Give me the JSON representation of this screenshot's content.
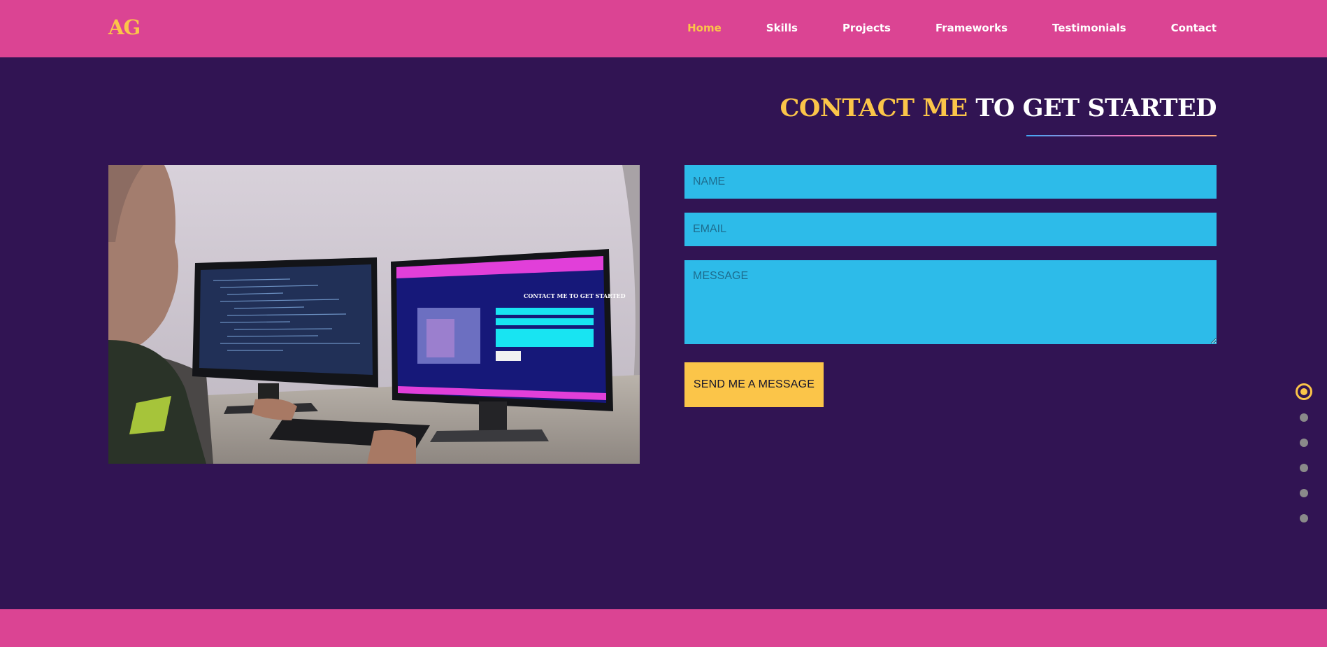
{
  "brand": {
    "logo": "AG"
  },
  "nav": {
    "items": [
      {
        "label": "Home",
        "active": true
      },
      {
        "label": "Skills"
      },
      {
        "label": "Projects"
      },
      {
        "label": "Frameworks"
      },
      {
        "label": "Testimonials"
      },
      {
        "label": "Contact"
      }
    ]
  },
  "contact": {
    "title_accent": "CONTACT ME",
    "title_rest": "TO GET STARTED",
    "name_placeholder": "NAME",
    "email_placeholder": "EMAIL",
    "message_placeholder": "MESSAGE",
    "send_label": "SEND ME A MESSAGE"
  },
  "photo": {
    "description_icon": "developer-at-desk-photo",
    "screen_title": "CONTACT ME TO GET STARTED"
  },
  "section_dots": {
    "count": 6,
    "active_index": 0
  },
  "colors": {
    "background": "#311453",
    "navbar": "#db4493",
    "accent": "#fbc549",
    "input": "#2dbbe9"
  }
}
